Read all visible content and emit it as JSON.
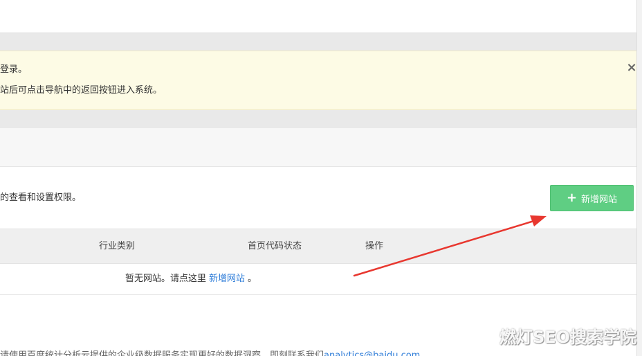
{
  "alert": {
    "line1": "登录。",
    "line2": "站后可点击导航中的返回按钮进入系统。",
    "close_glyph": "×"
  },
  "panel": {
    "description": "的查看和设置权限。",
    "add_button": {
      "plus": "+",
      "label": "新增网站"
    }
  },
  "table": {
    "headers": [
      "行业类别",
      "首页代码状态",
      "操作"
    ],
    "empty": {
      "text": "暂无网站。请点这里",
      "link": "新增网站",
      "suffix": "。"
    }
  },
  "footer": {
    "text": "请使用百度统计分析云提供的企业级数据服务实现更好的数据洞察，即刻联系我们",
    "email": "analytics@baidu.com"
  },
  "watermark": "燃灯SEO搜索学院",
  "colors": {
    "accent_green": "#5fce83",
    "link_blue": "#2d7cd8",
    "alert_bg": "#fdfbe5",
    "annotation_red": "#e8372f"
  }
}
